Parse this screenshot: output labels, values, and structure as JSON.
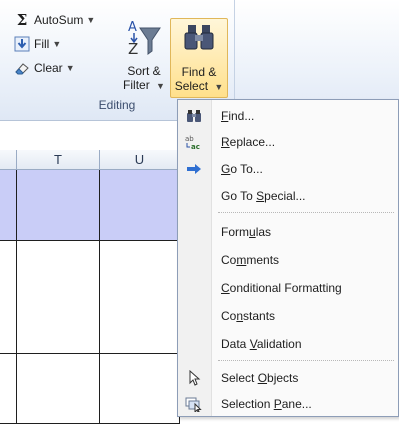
{
  "ribbon": {
    "autosum": {
      "label": "AutoSum",
      "icon": "sigma-icon"
    },
    "fill": {
      "label": "Fill",
      "icon": "fill-down-icon"
    },
    "clear": {
      "label": "Clear",
      "icon": "eraser-icon"
    },
    "sort_filter": {
      "line1": "Sort &",
      "line2": "Filter",
      "icon": "sort-filter-icon"
    },
    "find_select": {
      "line1": "Find &",
      "line2": "Select",
      "icon": "binoculars-icon"
    },
    "group_label": "Editing"
  },
  "sheet": {
    "columns": [
      "T",
      "U"
    ],
    "selection_color": "#c9cdf7"
  },
  "menu": {
    "items": [
      {
        "pre": "",
        "key": "F",
        "post": "ind...",
        "icon": "binoculars-icon"
      },
      {
        "pre": "",
        "key": "R",
        "post": "eplace...",
        "icon": "replace-icon"
      },
      {
        "pre": "",
        "key": "G",
        "post": "o To...",
        "icon": "arrow-right-icon"
      },
      {
        "pre": "Go To ",
        "key": "S",
        "post": "pecial...",
        "icon": ""
      },
      {
        "pre": "Form",
        "key": "u",
        "post": "las",
        "icon": ""
      },
      {
        "pre": "Co",
        "key": "m",
        "post": "ments",
        "icon": ""
      },
      {
        "pre": "",
        "key": "C",
        "post": "onditional Formatting",
        "icon": ""
      },
      {
        "pre": "Co",
        "key": "n",
        "post": "stants",
        "icon": ""
      },
      {
        "pre": "Data ",
        "key": "V",
        "post": "alidation",
        "icon": ""
      },
      {
        "pre": "Select ",
        "key": "O",
        "post": "bjects",
        "icon": "cursor-arrow-icon"
      },
      {
        "pre": "Selection ",
        "key": "P",
        "post": "ane...",
        "icon": "selection-pane-icon"
      }
    ]
  }
}
